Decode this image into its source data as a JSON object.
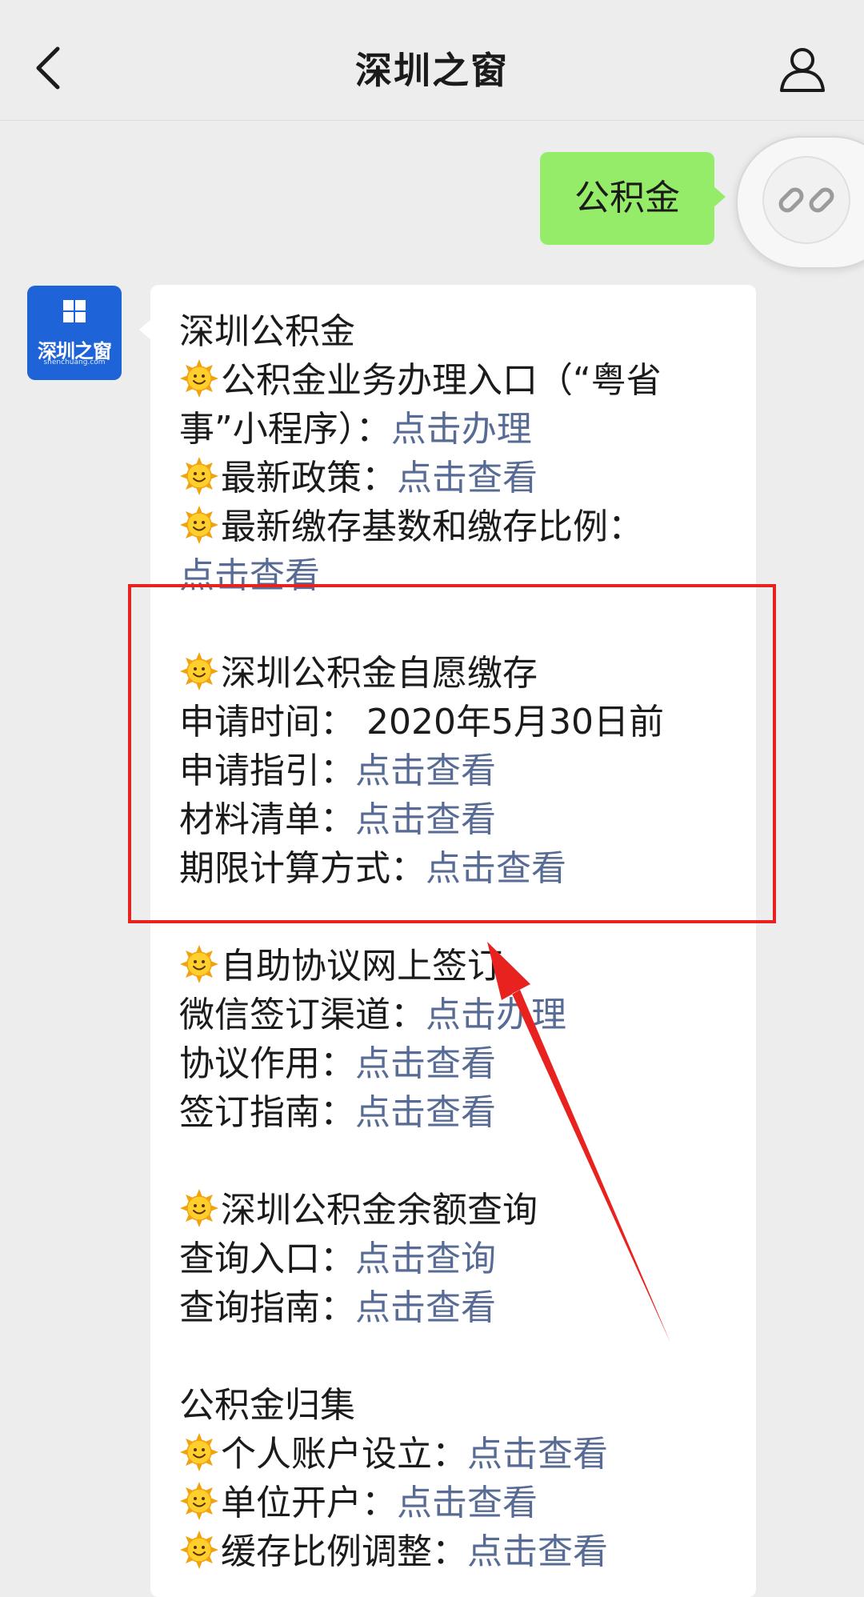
{
  "header": {
    "title": "深圳之窗",
    "back_icon": "chevron-left-icon",
    "profile_icon": "person-icon"
  },
  "user_message": {
    "text": "公积金",
    "bubble_color": "#95ec69"
  },
  "avatar": {
    "name": "深圳之窗",
    "sub": "shenchuang.com",
    "color": "#1e63d8"
  },
  "bot_message": {
    "link_color": "#576b95",
    "lines": [
      {
        "type": "text",
        "text": "深圳公积金"
      },
      {
        "type": "item",
        "emoji": true,
        "text": "公积金业务办理入口（“粤省"
      },
      {
        "type": "item",
        "emoji": false,
        "text": "事”小程序）：",
        "link": "点击办理"
      },
      {
        "type": "item",
        "emoji": true,
        "text": "最新政策：",
        "link": "点击查看"
      },
      {
        "type": "item",
        "emoji": true,
        "text": "最新缴存基数和缴存比例："
      },
      {
        "type": "item",
        "emoji": false,
        "text": "",
        "link": "点击查看"
      },
      {
        "type": "gap"
      },
      {
        "type": "item",
        "emoji": true,
        "text": "深圳公积金自愿缴存"
      },
      {
        "type": "item",
        "emoji": false,
        "text": "申请时间： 2020年5月30日前"
      },
      {
        "type": "item",
        "emoji": false,
        "text": "申请指引：",
        "link": "点击查看"
      },
      {
        "type": "item",
        "emoji": false,
        "text": "材料清单：",
        "link": "点击查看"
      },
      {
        "type": "item",
        "emoji": false,
        "text": "期限计算方式：",
        "link": "点击查看"
      },
      {
        "type": "gap"
      },
      {
        "type": "item",
        "emoji": true,
        "text": "自助协议网上签订"
      },
      {
        "type": "item",
        "emoji": false,
        "text": "微信签订渠道：",
        "link": "点击办理"
      },
      {
        "type": "item",
        "emoji": false,
        "text": "协议作用：",
        "link": "点击查看"
      },
      {
        "type": "item",
        "emoji": false,
        "text": "签订指南：",
        "link": "点击查看"
      },
      {
        "type": "gap"
      },
      {
        "type": "item",
        "emoji": true,
        "text": "深圳公积金余额查询"
      },
      {
        "type": "item",
        "emoji": false,
        "text": "查询入口：",
        "link": "点击查询"
      },
      {
        "type": "item",
        "emoji": false,
        "text": "查询指南：",
        "link": "点击查看"
      },
      {
        "type": "gap"
      },
      {
        "type": "text",
        "text": "公积金归集"
      },
      {
        "type": "item",
        "emoji": true,
        "text": "个人账户设立：",
        "link": "点击查看"
      },
      {
        "type": "item",
        "emoji": true,
        "text": "单位开户：",
        "link": "点击查看"
      },
      {
        "type": "item",
        "emoji": true,
        "text": "缓存比例调整：",
        "link": "点击查看"
      }
    ]
  },
  "annotation": {
    "color": "#e8221e",
    "highlight": "red-rectangle",
    "pointer": "red-arrow"
  },
  "floating_button": {
    "icon": "link-icon"
  }
}
